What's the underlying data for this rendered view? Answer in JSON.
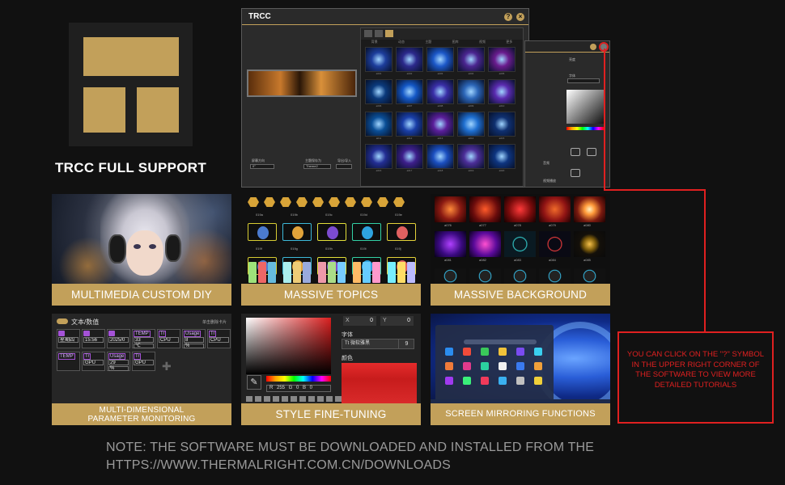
{
  "brand": {
    "caption": "TRCC FULL SUPPORT",
    "colors": {
      "gold": "#c2a05a",
      "background": "#111111",
      "alert_red": "#e02020"
    }
  },
  "app_window": {
    "title": "TRCC",
    "help_button": "?",
    "close_button": "×",
    "controls": [
      {
        "label": "屏幕方向",
        "value": "0°"
      },
      {
        "label": "主题保存为",
        "value": "Theme2"
      },
      {
        "label": "导出/导入",
        "value": ""
      }
    ],
    "gallery_columns": [
      "背景",
      "动态",
      "主题",
      "图库",
      "视频",
      "更多"
    ],
    "gallery_items": [
      "a001",
      "a002",
      "a003",
      "a004",
      "a005",
      "a006",
      "a007",
      "a008",
      "a009",
      "a010",
      "a011",
      "a012",
      "a013",
      "a014",
      "a015",
      "a016",
      "a017",
      "a018",
      "a019",
      "a020"
    ]
  },
  "side_window": {
    "items": [
      "亮度",
      "字体",
      "颜色",
      "音频",
      "视频播放",
      "播放"
    ]
  },
  "features": [
    {
      "id": "multimedia",
      "caption": "MULTIMEDIA CUSTOM DIY"
    },
    {
      "id": "topics",
      "caption": "MASSIVE TOPICS"
    },
    {
      "id": "background",
      "caption": "MASSIVE BACKGROUND"
    },
    {
      "id": "monitoring",
      "caption_line1": "MULTI-DIMENSIONAL",
      "caption_line2": "PARAMETER MONITORING"
    },
    {
      "id": "style",
      "caption": "STYLE FINE-TUNING"
    },
    {
      "id": "mirror",
      "caption": "SCREEN MIRRORING FUNCTIONS"
    }
  ],
  "topics_labels": [
    "019a",
    "019b",
    "019c",
    "019d",
    "019e",
    "019f",
    "019g",
    "019h",
    "019i",
    "019j"
  ],
  "background_labels": [
    "a076",
    "a077",
    "a078",
    "a079",
    "a080",
    "a081",
    "a082",
    "a083",
    "a084",
    "a085"
  ],
  "monitoring": {
    "heading": "文本/数值",
    "hint": "单击删除卡片",
    "cells": [
      {
        "tag": "",
        "v1": "星期四",
        "v2": ""
      },
      {
        "tag": "",
        "v1": "15:56",
        "v2": ""
      },
      {
        "tag": "",
        "v1": "2025/0",
        "v2": ""
      },
      {
        "tag": "TEMP",
        "v1": "33",
        "v2": "℃"
      },
      {
        "tag": "Tr",
        "v1": "CPU",
        "v2": ""
      },
      {
        "tag": "Usage",
        "v1": "8",
        "v2": "%"
      },
      {
        "tag": "Tr",
        "v1": "CPU",
        "v2": ""
      },
      {
        "tag": "TEMP",
        "v1": "",
        "v2": ""
      },
      {
        "tag": "Tr",
        "v1": "GPU",
        "v2": ""
      },
      {
        "tag": "Usage",
        "v1": "29",
        "v2": "%"
      },
      {
        "tag": "Tr",
        "v1": "GPU",
        "v2": ""
      }
    ]
  },
  "style_panel": {
    "x_label": "X",
    "x_value": "0",
    "y_label": "Y",
    "y_value": "0",
    "font_label": "字体",
    "font_icon": "Tt",
    "font_name": "微软雅黑",
    "font_size": "9",
    "color_label": "颜色",
    "rgb_text": "R 255 G 0 B 0",
    "current_color": "#e52b2b"
  },
  "callout": {
    "text": "YOU CAN CLICK ON THE \"?\" SYMBOL IN THE UPPER RIGHT CORNER OF THE SOFTWARE TO VIEW MORE DETAILED TUTORIALS"
  },
  "note": {
    "line1": "NOTE: THE SOFTWARE MUST BE DOWNLOADED AND INSTALLED FROM THE",
    "line2": "HTTPS://WWW.THERMALRIGHT.COM.CN/DOWNLOADS"
  }
}
